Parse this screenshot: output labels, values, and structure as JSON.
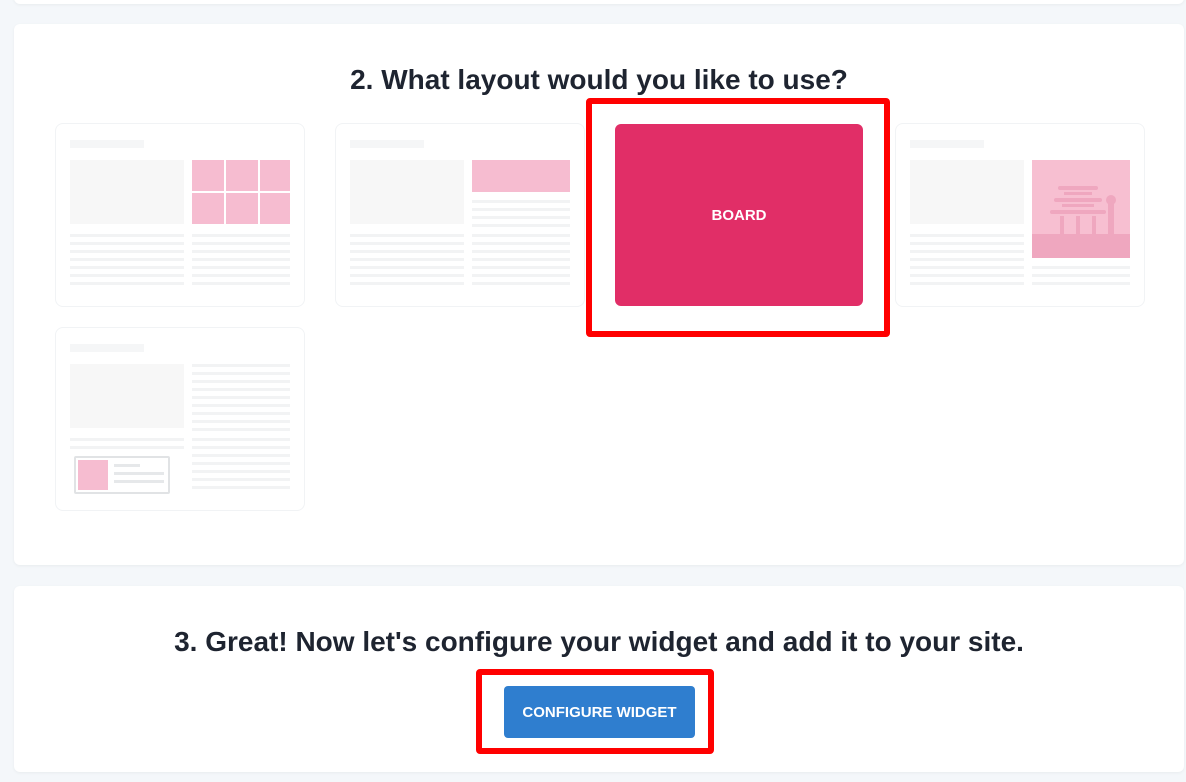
{
  "layout_section": {
    "title": "2. What layout would you like to use?",
    "options": [
      {
        "id": "grid"
      },
      {
        "id": "slider"
      },
      {
        "id": "board",
        "label": "BOARD",
        "selected": true
      },
      {
        "id": "single"
      },
      {
        "id": "popup"
      }
    ]
  },
  "config_section": {
    "title": "3. Great! Now let's configure your widget and add it to your site.",
    "button_label": "CONFIGURE WIDGET"
  },
  "colors": {
    "accent_pink": "#e12e67",
    "button_blue": "#2f7ecf",
    "highlight_red": "#ff0000"
  }
}
